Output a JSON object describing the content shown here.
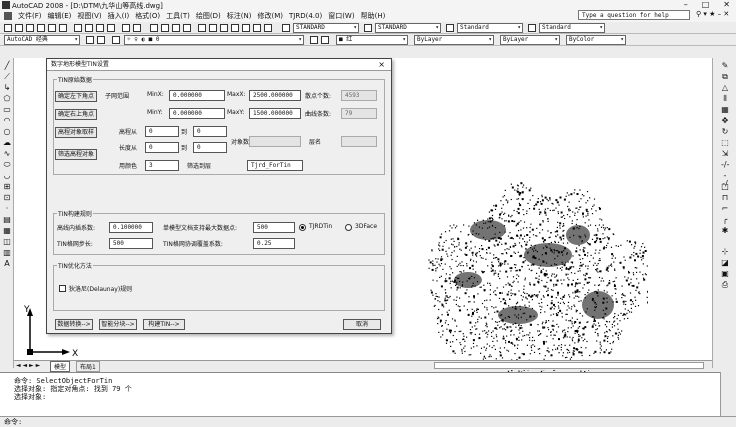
{
  "window": {
    "title": "AutoCAD 2008 - [D:\\DTM\\九华山等高线.dwg]",
    "controls": [
      "–",
      "□",
      "✕"
    ]
  },
  "menu": {
    "items": [
      "文件(F)",
      "编辑(E)",
      "视图(V)",
      "插入(I)",
      "格式(O)",
      "工具(T)",
      "绘图(D)",
      "标注(N)",
      "修改(M)",
      "TJRD(4.0)",
      "窗口(W)",
      "帮助(H)"
    ],
    "help_placeholder": "Type a question for help"
  },
  "toolbar1": {
    "text_style": "STANDARD",
    "dim_style": "STANDARD",
    "table_style": "Standard",
    "mleader_style": "Standard"
  },
  "toolbar2": {
    "workspace": "AutoCAD 经典",
    "layer": "■ 红",
    "color": "ByLayer",
    "linetype": "ByLayer",
    "lineweight": "ByColor"
  },
  "dialog": {
    "title": "数字地形模型TIN设置",
    "close": "×",
    "group_source": "TIN原始数据",
    "btn_lower_left": "确定左下角点",
    "btn_upper_right": "确定右上角点",
    "label_subrange": "子网范围",
    "minx_label": "MinX:",
    "minx_value": "0.000000",
    "maxx_label": "MaxX:",
    "maxx_value": "2500.000000",
    "miny_label": "MinY:",
    "miny_value": "0.000000",
    "maxy_label": "MaxY:",
    "maxy_value": "1500.000000",
    "point_count_label": "散点个数:",
    "point_count_value": "4593",
    "line_count_label": "曲线条数:",
    "line_count_value": "79",
    "btn_elev_object": "高程对象取样",
    "btn_filter_elev": "筛选高程对象",
    "elev_from_label": "高程从",
    "elev_from_value": "0",
    "elev_to_label": "到",
    "elev_to_value": "0",
    "length_from_label": "长度从",
    "length_from_value": "0",
    "length_to_label": "到",
    "length_to_value": "0",
    "object_count_label": "对象数",
    "layer_label": "层名",
    "color_label": "用颜色",
    "color_value": "3",
    "filter_layer_label": "筛选到层",
    "filter_layer_value": "Tjrd_ForTin",
    "group_build": "TIN构建规则",
    "interp_label": "高线内插系数:",
    "interp_value": "0.100000",
    "max_pts_label": "单模型文档支持最大数据点:",
    "max_pts_value": "500",
    "radio_tjrd": "TJRDTin",
    "radio_3dface": "3DFace",
    "step_label": "TIN格网步长:",
    "step_value": "500",
    "overlap_label": "TIN格网协调覆盖系数:",
    "overlap_value": "0.25",
    "group_optimize": "TIN优化方法",
    "delaunay_label": "狄洛尼(Delaunay)规则",
    "btn_data_convert": "数据转换-->",
    "btn_smart_block": "智能分块-->",
    "btn_build_tin": "构建TIN-->",
    "btn_cancel": "取消"
  },
  "tabs": {
    "nav": "◄ ◄ ► ►",
    "model": "模型",
    "layout": "布局1"
  },
  "command": {
    "line1": "命令:  SelectObjectForTin",
    "line2": "选择对象: 指定对角点: 找到 79 个",
    "line3": "选择对象:",
    "prompt": "命令:"
  },
  "ucs": {
    "x_label": "X",
    "y_label": "Y"
  },
  "colors": {
    "background": "#ececec",
    "canvas": "#ffffff",
    "dialog": "#efefef"
  }
}
